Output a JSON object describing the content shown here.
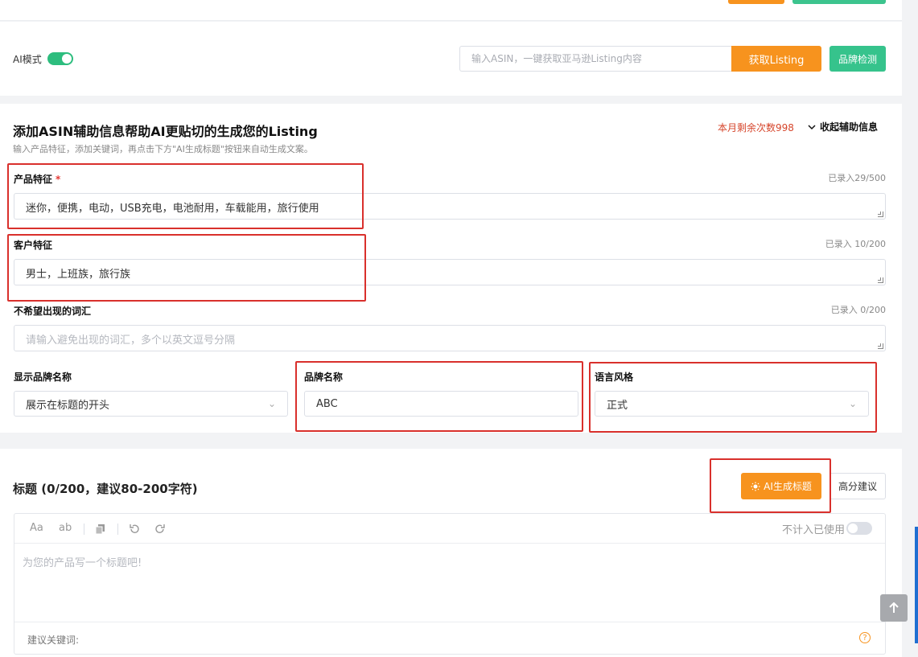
{
  "ai_mode": {
    "label": "AI模式",
    "enabled": true
  },
  "asin": {
    "placeholder": "输入ASIN，一键获取亚马逊Listing内容",
    "fetch_label": "获取Listing",
    "brand_check_label": "品牌检测"
  },
  "assist": {
    "title": "添加ASIN辅助信息帮助AI更贴切的生成您的Listing",
    "subtitle": "输入产品特征，添加关键词，再点击下方\"AI生成标题\"按钮来自动生成文案。",
    "remaining": "本月剩余次数998",
    "collapse_label": "收起辅助信息"
  },
  "fields": {
    "product": {
      "label": "产品特征",
      "required_mark": "*",
      "count": "已录入29/500",
      "value": "迷你，便携，电动，USB充电，电池耐用，车载能用，旅行使用"
    },
    "customer": {
      "label": "客户特征",
      "count": "已录入 10/200",
      "value": "男士，上班族，旅行族"
    },
    "avoid": {
      "label": "不希望出现的词汇",
      "count": "已录入 0/200",
      "placeholder": "请输入避免出现的词汇，多个以英文逗号分隔"
    },
    "brand_display": {
      "label": "显示品牌名称",
      "value": "展示在标题的开头"
    },
    "brand_name": {
      "label": "品牌名称",
      "value": "ABC"
    },
    "language_style": {
      "label": "语言风格",
      "value": "正式"
    }
  },
  "title_section": {
    "heading": "标题 (0/200，建议80-200字符)",
    "ai_button": "AI生成标题",
    "score_button": "高分建议",
    "toolbar": {
      "font_case": "Aa",
      "lower_case": "ab"
    },
    "not_count_label": "不计入已使用",
    "not_count_enabled": false,
    "placeholder": "为您的产品写一个标题吧!",
    "keywords_label": "建议关键词:"
  },
  "colors": {
    "accent_orange": "#f7931e",
    "accent_green": "#36c38c",
    "highlight_red": "#d9302c",
    "remaining_red": "#d6452b"
  },
  "icons": [
    "chevron-down-icon",
    "sun-icon",
    "copy-icon",
    "undo-icon",
    "redo-icon",
    "help-icon",
    "arrow-up-icon",
    "resize-handle-icon"
  ]
}
